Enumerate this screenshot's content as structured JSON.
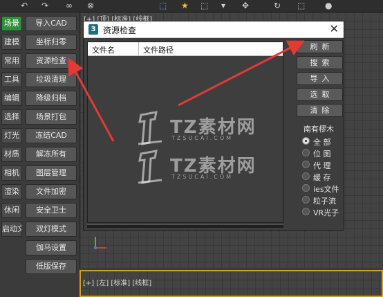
{
  "toolbar": {
    "icons": [
      "undo-icon",
      "redo-icon",
      "link-icon",
      "select-icon",
      "star-icon",
      "region-icon",
      "dropdown-icon",
      "snap-icon"
    ]
  },
  "categories": [
    {
      "label": "场景",
      "active": true
    },
    {
      "label": "建模",
      "active": false
    },
    {
      "label": "常用",
      "active": false
    },
    {
      "label": "工具",
      "active": false
    },
    {
      "label": "编辑",
      "active": false
    },
    {
      "label": "选择",
      "active": false
    },
    {
      "label": "灯光",
      "active": false
    },
    {
      "label": "材质",
      "active": false
    },
    {
      "label": "相机",
      "active": false
    },
    {
      "label": "渲染",
      "active": false
    },
    {
      "label": "休闲",
      "active": false
    },
    {
      "label": "启动文",
      "active": false
    }
  ],
  "commands": [
    "导入CAD",
    "坐标归零",
    "资源检查",
    "垃圾清理",
    "降级归档",
    "场景打包",
    "冻结CAD",
    "解冻所有",
    "图层管理",
    "文件加密",
    "安全卫士",
    "双灯模式",
    "伽马设置",
    "低版保存"
  ],
  "viewport_top": {
    "label": "[+] [顶] [标准] [线框]"
  },
  "viewport_left": {
    "label": "[+] [左] [标准] [线框]"
  },
  "dialog": {
    "title": "资源检查",
    "app_icon_text": "3",
    "close": "✕",
    "columns": [
      "文件名",
      "文件路径"
    ],
    "buttons": [
      "刷新",
      "搜索",
      "导入",
      "选取",
      "清除"
    ],
    "filter_group_title": "南有樛木",
    "filters": [
      {
        "label": "全 部",
        "selected": true
      },
      {
        "label": "位 图",
        "selected": false
      },
      {
        "label": "代 理",
        "selected": false
      },
      {
        "label": "缓 存",
        "selected": false
      },
      {
        "label": "ies文件",
        "selected": false
      },
      {
        "label": "粒子流",
        "selected": false
      },
      {
        "label": "VR光子",
        "selected": false
      }
    ]
  },
  "watermark": {
    "brand": "TZ素材网",
    "domain": "TZSUCAI.COM"
  },
  "colors": {
    "accent_green": "#2f8f3a",
    "arrow_red": "#e53935",
    "active_viewport": "#c9a227"
  }
}
